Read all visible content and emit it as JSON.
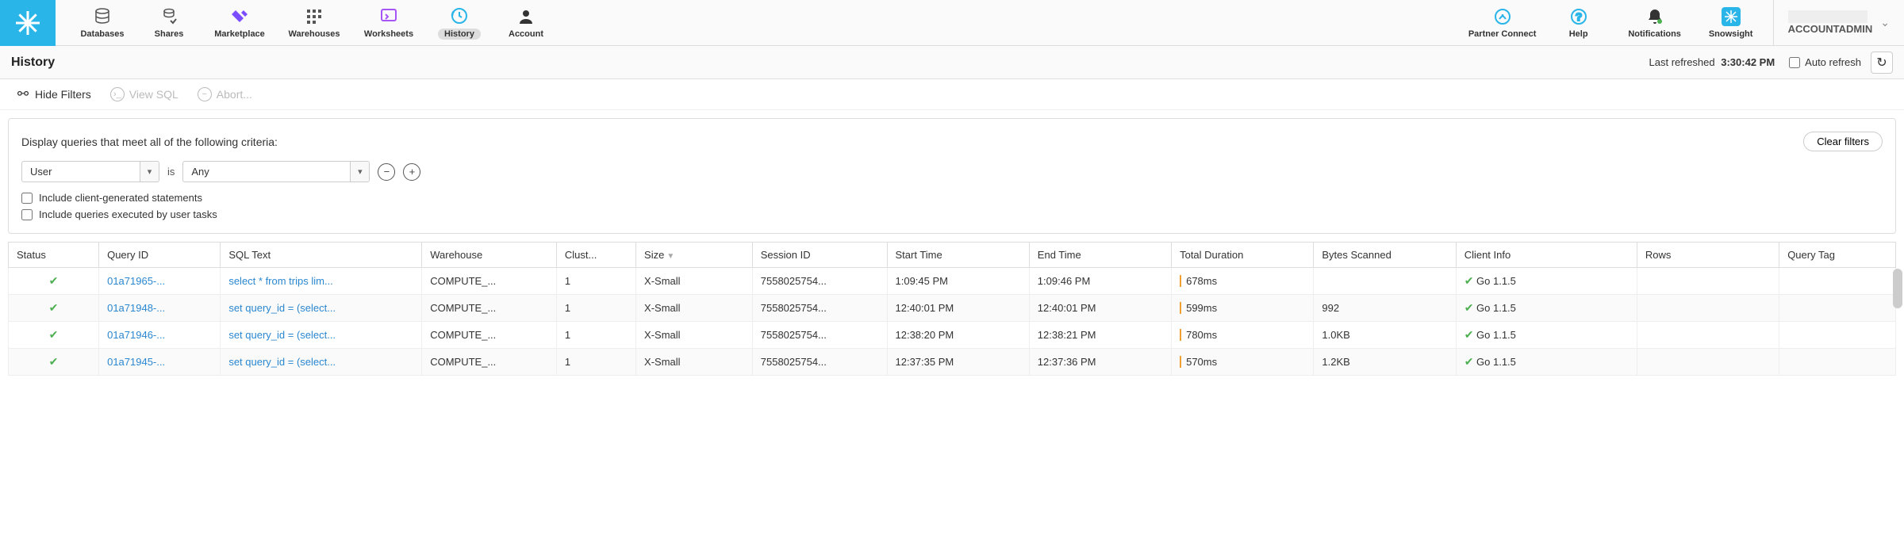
{
  "nav": [
    {
      "label": "Databases",
      "icon": "db"
    },
    {
      "label": "Shares",
      "icon": "share"
    },
    {
      "label": "Marketplace",
      "icon": "mkt"
    },
    {
      "label": "Warehouses",
      "icon": "wh"
    },
    {
      "label": "Worksheets",
      "icon": "ws"
    },
    {
      "label": "History",
      "icon": "hist",
      "active": true
    },
    {
      "label": "Account",
      "icon": "acct"
    }
  ],
  "nav_right": [
    {
      "label": "Partner Connect",
      "icon": "pc"
    },
    {
      "label": "Help",
      "icon": "help"
    },
    {
      "label": "Notifications",
      "icon": "bell"
    },
    {
      "label": "Snowsight",
      "icon": "snow"
    }
  ],
  "account_role": "ACCOUNTADMIN",
  "page_title": "History",
  "last_refreshed_label": "Last refreshed",
  "last_refreshed_time": "3:30:42 PM",
  "auto_refresh_label": "Auto refresh",
  "toolbar": {
    "hide_filters": "Hide Filters",
    "view_sql": "View SQL",
    "abort": "Abort..."
  },
  "filters": {
    "criteria_text": "Display queries that meet all of the following criteria:",
    "clear": "Clear filters",
    "field": "User",
    "is": "is",
    "value": "Any",
    "include_client": "Include client-generated statements",
    "include_tasks": "Include queries executed by user tasks"
  },
  "columns": [
    "Status",
    "Query ID",
    "SQL Text",
    "Warehouse",
    "Clust...",
    "Size",
    "Session ID",
    "Start Time",
    "End Time",
    "Total Duration",
    "Bytes Scanned",
    "Client Info",
    "Rows",
    "Query Tag"
  ],
  "rows": [
    {
      "qid": "01a71965-...",
      "sql": "select * from trips lim...",
      "wh": "COMPUTE_...",
      "cl": "1",
      "sz": "X-Small",
      "sess": "7558025754...",
      "st": "1:09:45 PM",
      "et": "1:09:46 PM",
      "dur": "678ms",
      "bytes": "",
      "ci": "Go 1.1.5",
      "rows": "",
      "tag": ""
    },
    {
      "qid": "01a71948-...",
      "sql": "set query_id = (select...",
      "wh": "COMPUTE_...",
      "cl": "1",
      "sz": "X-Small",
      "sess": "7558025754...",
      "st": "12:40:01 PM",
      "et": "12:40:01 PM",
      "dur": "599ms",
      "bytes": "992",
      "ci": "Go 1.1.5",
      "rows": "",
      "tag": ""
    },
    {
      "qid": "01a71946-...",
      "sql": "set query_id = (select...",
      "wh": "COMPUTE_...",
      "cl": "1",
      "sz": "X-Small",
      "sess": "7558025754...",
      "st": "12:38:20 PM",
      "et": "12:38:21 PM",
      "dur": "780ms",
      "bytes": "1.0KB",
      "ci": "Go 1.1.5",
      "rows": "",
      "tag": ""
    },
    {
      "qid": "01a71945-...",
      "sql": "set query_id = (select...",
      "wh": "COMPUTE_...",
      "cl": "1",
      "sz": "X-Small",
      "sess": "7558025754...",
      "st": "12:37:35 PM",
      "et": "12:37:36 PM",
      "dur": "570ms",
      "bytes": "1.2KB",
      "ci": "Go 1.1.5",
      "rows": "",
      "tag": ""
    }
  ]
}
